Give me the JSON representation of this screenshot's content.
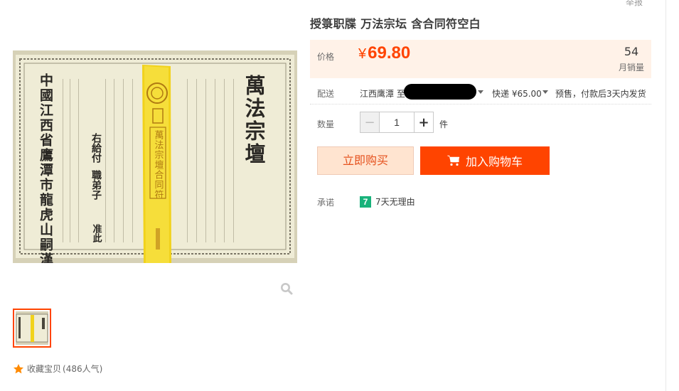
{
  "header": {
    "report_link": "举报"
  },
  "product": {
    "title": "授箓职牒 万法宗坛 含合同符空白"
  },
  "gallery": {
    "zoom_icon": "search-icon",
    "certificate_heading": "萬法宗壇",
    "certificate_issuer": "中國江西省鷹潭市龍虎山嗣漢天師府",
    "certificate_mid_1": "右給付",
    "certificate_mid_2": "職弟子",
    "certificate_mid_3": "准此",
    "talisman_text": "萬法宗壇合同符"
  },
  "favorites": {
    "label": "收藏宝贝",
    "count": "(486人气)",
    "icon": "star-icon"
  },
  "price": {
    "label": "价格",
    "currency": "¥",
    "value": "69.80",
    "monthly_sales": "54",
    "monthly_sales_label": "月销量"
  },
  "shipping": {
    "label": "配送",
    "origin": "江西鹰潭 至",
    "express": "快递 ¥65.00",
    "presale": "预售，付款后3天内发货"
  },
  "quantity": {
    "label": "数量",
    "value": "1",
    "unit": "件",
    "minus": "−",
    "plus": "+"
  },
  "actions": {
    "buy_now": "立即购买",
    "add_to_cart": "加入购物车"
  },
  "promise": {
    "label": "承诺",
    "badge": "7",
    "text": "7天无理由"
  },
  "colors": {
    "accent": "#ff4400",
    "price_bg": "#fff2e8",
    "badge_green": "#19b27b"
  }
}
